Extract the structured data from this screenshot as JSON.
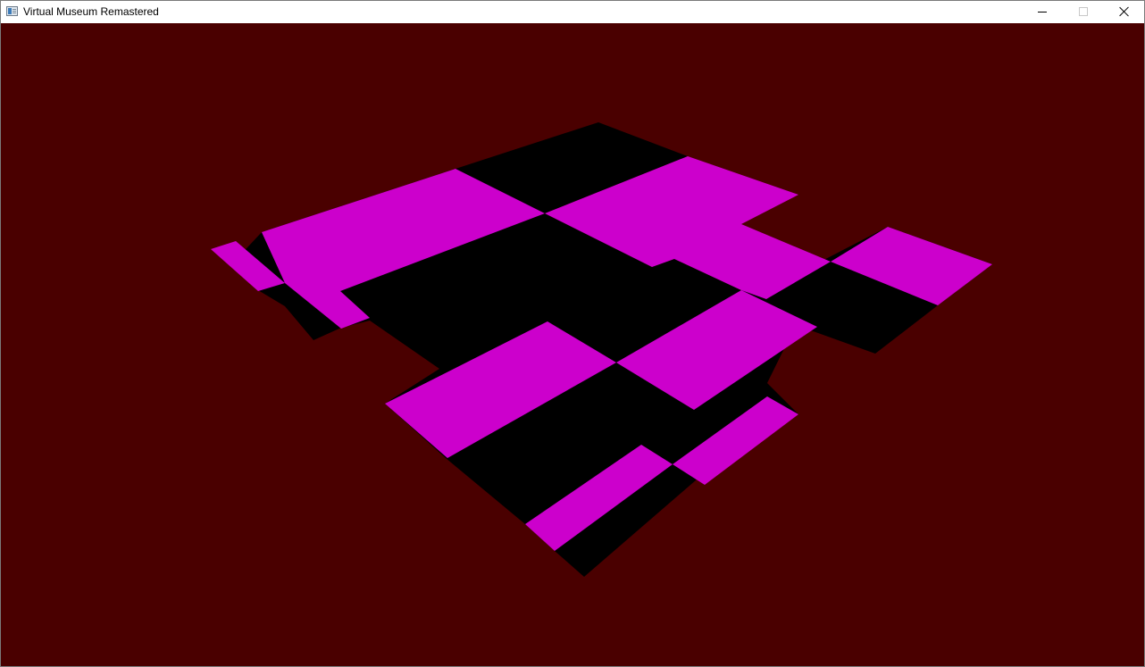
{
  "window": {
    "title": "Virtual Museum Remastered",
    "icon": "application-window-icon",
    "controls": {
      "minimize": "minimize-icon",
      "maximize": "maximize-icon",
      "maximize_enabled": false,
      "close": "close-icon"
    }
  },
  "scene": {
    "background_color": "#4a0000",
    "tile_colors": {
      "magenta": "#cc00cc",
      "black": "#000000"
    },
    "description_tiles": "checkered floor rendered in perspective"
  }
}
